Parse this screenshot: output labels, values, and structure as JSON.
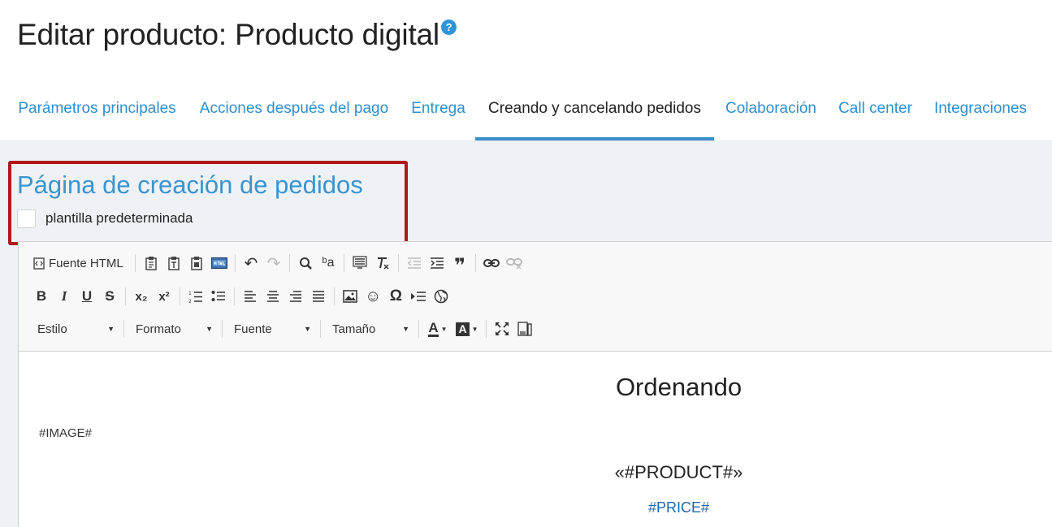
{
  "page": {
    "title": "Editar producto: Producto digital",
    "help_icon": "?"
  },
  "tabs": [
    {
      "label": "Parámetros principales",
      "active": false
    },
    {
      "label": "Acciones después del pago",
      "active": false
    },
    {
      "label": "Entrega",
      "active": false
    },
    {
      "label": "Creando y cancelando pedidos",
      "active": true
    },
    {
      "label": "Colaboración",
      "active": false
    },
    {
      "label": "Call center",
      "active": false
    },
    {
      "label": "Integraciones",
      "active": false
    }
  ],
  "section": {
    "title": "Página de creación de pedidos",
    "checkbox_label": "plantilla predeterminada",
    "checkbox_checked": false
  },
  "toolbar": {
    "source_label": "Fuente HTML",
    "combos": {
      "style": "Estilo",
      "format": "Formato",
      "font": "Fuente",
      "size": "Tamaño"
    },
    "glyphs": {
      "undo": "↶",
      "redo": "↷",
      "find": "🔍︎",
      "replace": "ᵇa",
      "quote": "❞",
      "bold": "B",
      "italic": "I",
      "underline": "U",
      "strike": "S",
      "subscript": "x₂",
      "superscript": "x²",
      "ordered_list": "⒈",
      "bullet_list": "•≡",
      "smiley": "☺",
      "omega": "Ω",
      "globe": "⊕",
      "text_color": "A",
      "bg_color": "A",
      "maximize": "⤧",
      "blocks": "▯"
    }
  },
  "document": {
    "heading": "Ordenando",
    "image_placeholder": "#IMAGE#",
    "product_placeholder": "«#PRODUCT#»",
    "price_placeholder": "#PRICE#"
  },
  "colors": {
    "accent": "#3a94cf",
    "tab_link": "#2f8fd0",
    "highlight_border": "#b1171c",
    "price": "#2166a8",
    "content_bg": "#eef2f6"
  }
}
